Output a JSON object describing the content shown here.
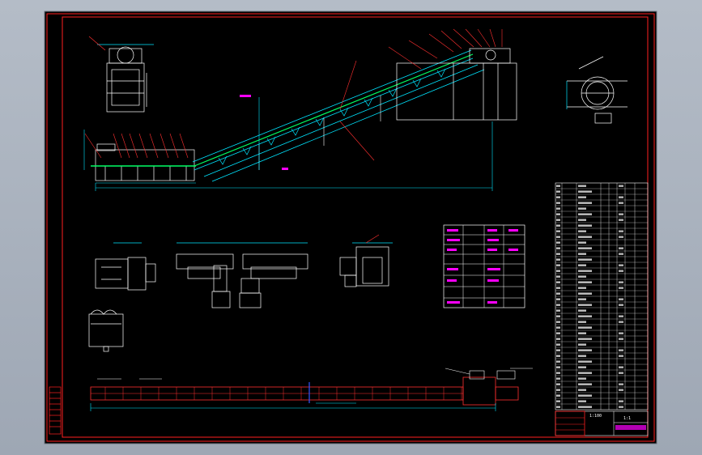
{
  "colors": {
    "background": "#000000",
    "frame": "#ff2020",
    "outline": "#ffffff",
    "conveyor": "#00e5ff",
    "belt": "#00ff66",
    "dimension": "#00e5ff",
    "label": "#ff00ff",
    "leader": "#ff3030",
    "text": "#ffffff"
  },
  "title_block": {
    "scale": "1:100",
    "sheet": "1:1"
  }
}
